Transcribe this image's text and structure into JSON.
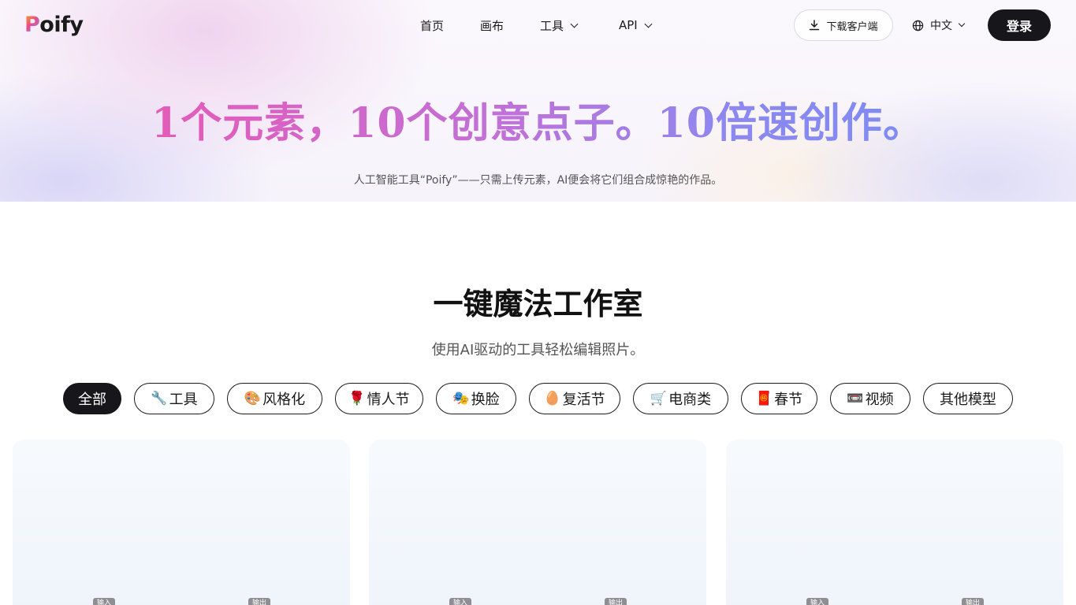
{
  "header": {
    "logo_text": "Poify",
    "logo_rest": "oify",
    "logo_initial": "P",
    "nav": [
      {
        "label": "首页"
      },
      {
        "label": "画布"
      },
      {
        "label": "工具"
      },
      {
        "label": "API"
      }
    ],
    "download_label": "下载客户端",
    "language_label": "中文",
    "login_label": "登录"
  },
  "hero": {
    "title": "1个元素，10个创意点子。10倍速创作。",
    "subtitle": "人工智能工具“Poify”——只需上传元素，AI便会将它们组合成惊艳的作品。"
  },
  "studio": {
    "title": "一键魔法工作室",
    "subtitle": "使用AI驱动的工具轻松编辑照片。",
    "categories": [
      {
        "label": "全部",
        "emoji": ""
      },
      {
        "label": "工具",
        "emoji": "🔧"
      },
      {
        "label": "风格化",
        "emoji": "🎨"
      },
      {
        "label": "情人节",
        "emoji": "🌹"
      },
      {
        "label": "换脸",
        "emoji": "🎭"
      },
      {
        "label": "复活节",
        "emoji": "🥚"
      },
      {
        "label": "电商类",
        "emoji": "🛒"
      },
      {
        "label": "春节",
        "emoji": "🧧"
      },
      {
        "label": "视频",
        "emoji": "📼"
      },
      {
        "label": "其他模型",
        "emoji": ""
      }
    ],
    "cards": [
      {
        "input_tag": "输入",
        "output_tag": "输出"
      },
      {
        "input_tag": "输入",
        "output_tag": "输出"
      },
      {
        "input_tag": "输入",
        "output_tag": "输出"
      }
    ]
  },
  "colors": {
    "accent_dark": "#17171b",
    "gradient_start": "#e45bb8",
    "gradient_end": "#7e8cf3"
  }
}
